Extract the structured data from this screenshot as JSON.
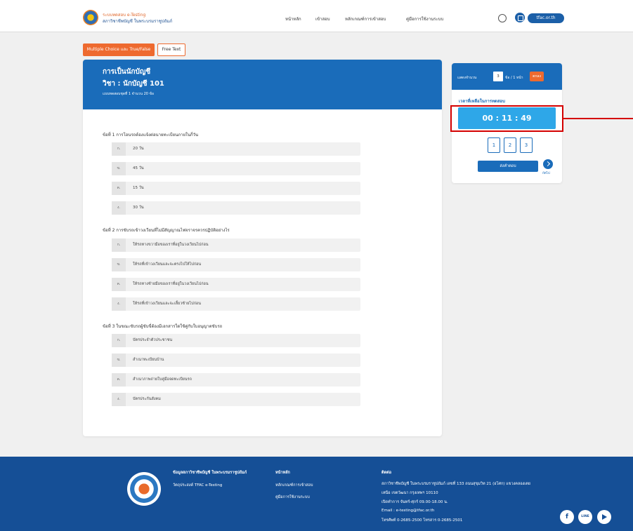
{
  "header": {
    "brand_line1": "ระบบทดสอบ e-Testing",
    "brand_line2": "สภาวิชาชีพบัญชี ในพระบรมราชูปถัมภ์",
    "nav": [
      "หน้าหลัก",
      "เข้าสอบ",
      "หลักเกณฑ์การเข้าสอบ",
      "คู่มือการใช้งานระบบ"
    ],
    "site_label": "tfac.or.th",
    "user_icon": "user-circle-icon",
    "bag_icon": "bag-icon"
  },
  "tabs": {
    "multiple_choice": "Multiple Choice และ True/False",
    "free_text": "Free Text"
  },
  "exam": {
    "course_title": "การเป็นนักบัญชี",
    "subject": "วิชา : นักบัญชี 101",
    "meta": "แบบทดสอบชุดที่ 1 จำนวน 20 ข้อ",
    "questions": [
      {
        "text": "ข้อที่ 1 การโอนรถต้องแจ้งต่อนายทะเบียนภายในกี่วัน",
        "options": [
          {
            "letter": "ก.",
            "text": "20 วัน"
          },
          {
            "letter": "ข.",
            "text": "45 วัน"
          },
          {
            "letter": "ค.",
            "text": "15 วัน"
          },
          {
            "letter": "ง.",
            "text": "30 วัน"
          }
        ]
      },
      {
        "text": "ข้อที่ 2 การขับรถเข้าวงเวียนที่ไม่มีสัญญาณไฟจราจรควรปฏิบัติอย่างไร",
        "options": [
          {
            "letter": "ก.",
            "text": "ให้รถทางขวามือของเราที่อยู่ในวงเวียนไปก่อน"
          },
          {
            "letter": "ข.",
            "text": "ให้รถที่เข้าวงเวียนและจะตรงไปให้ไปก่อน"
          },
          {
            "letter": "ค.",
            "text": "ให้รถทางซ้ายมือของเราที่อยู่ในวงเวียนไปก่อน"
          },
          {
            "letter": "ง.",
            "text": "ให้รถที่เข้าวงเวียนและจะเลี้ยวซ้ายไปก่อน"
          }
        ]
      },
      {
        "text": "ข้อที่ 3 ในขณะขับรถผู้ขับขี่ต้องมีเอกสารใดใช้คู่กับใบอนุญาตขับรถ",
        "options": [
          {
            "letter": "ก.",
            "text": "บัตรประจำตัวประชาชน"
          },
          {
            "letter": "ข.",
            "text": "สำเนาทะเบียนบ้าน"
          },
          {
            "letter": "ค.",
            "text": "สำเนาภาพถ่ายใบคู่มือจดทะเบียนรถ"
          },
          {
            "letter": "ง.",
            "text": "บัตรประกันสังคม"
          }
        ]
      }
    ]
  },
  "side": {
    "per_page_prefix": "แสดงจำนวน",
    "per_page_value": "3",
    "per_page_suffix": "ข้อ / 1 หน้า",
    "confirm_label": "ตกลง",
    "time_label": "เวลาที่เหลือในการทดสอบ",
    "timer": "00 : 11 : 49",
    "pages": [
      "1",
      "2",
      "3"
    ],
    "submit_label": "ส่งคำตอบ",
    "next_label": "ถัดไป",
    "next_icon": "chevron-right-icon"
  },
  "footer": {
    "col1": [
      "ข้อมูลสภาวิชาชีพบัญชี ในพระบรมราชูปถัมภ์",
      "วัตถุประสงค์ TFAC e-Testing"
    ],
    "col2": [
      "หน้าหลัก",
      "หลักเกณฑ์การเข้าสอบ",
      "คู่มือการใช้งานระบบ"
    ],
    "contact_title": "ติดต่อ",
    "contact_lines": [
      "สภาวิชาชีพบัญชี ในพระบรมราชูปถัมภ์ เลขที่ 133 ถนนสุขุมวิท 21 (อโศก) แขวงคลองเตย",
      "เหนือ เขตวัฒนา กรุงเทพฯ 10110",
      "เปิดทำการ จันทร์-ศุกร์ 09.00-18.00 น.",
      "Email : e-testing@tfac.or.th",
      "โทรศัพท์ 0-2685-2500 โทรสาร 0-2685-2501"
    ],
    "social": {
      "facebook": "f",
      "line": "LINE",
      "youtube": "youtube-icon"
    }
  }
}
